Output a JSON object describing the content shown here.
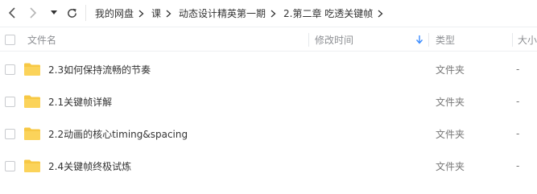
{
  "breadcrumb": [
    "我的网盘",
    "课",
    "动态设计精英第一期",
    "2.第二章 吃透关键帧"
  ],
  "columns": {
    "name": "文件名",
    "modified": "修改时间",
    "type": "类型",
    "size": "大小"
  },
  "files": [
    {
      "name": "2.3如何保持流畅的节奏",
      "type": "文件夹",
      "size": "-"
    },
    {
      "name": "2.1关键帧详解",
      "type": "文件夹",
      "size": "-"
    },
    {
      "name": "2.2动画的核心timing&spacing",
      "type": "文件夹",
      "size": "-"
    },
    {
      "name": "2.4关键帧终极试炼",
      "type": "文件夹",
      "size": "-"
    }
  ],
  "colors": {
    "folder": "#f7c844",
    "accent": "#3b8cff"
  },
  "icons": [
    "back-icon",
    "forward-icon",
    "history-dropdown-icon",
    "refresh-icon",
    "breadcrumb-chevron-icon",
    "sort-descending-icon",
    "folder-icon"
  ]
}
